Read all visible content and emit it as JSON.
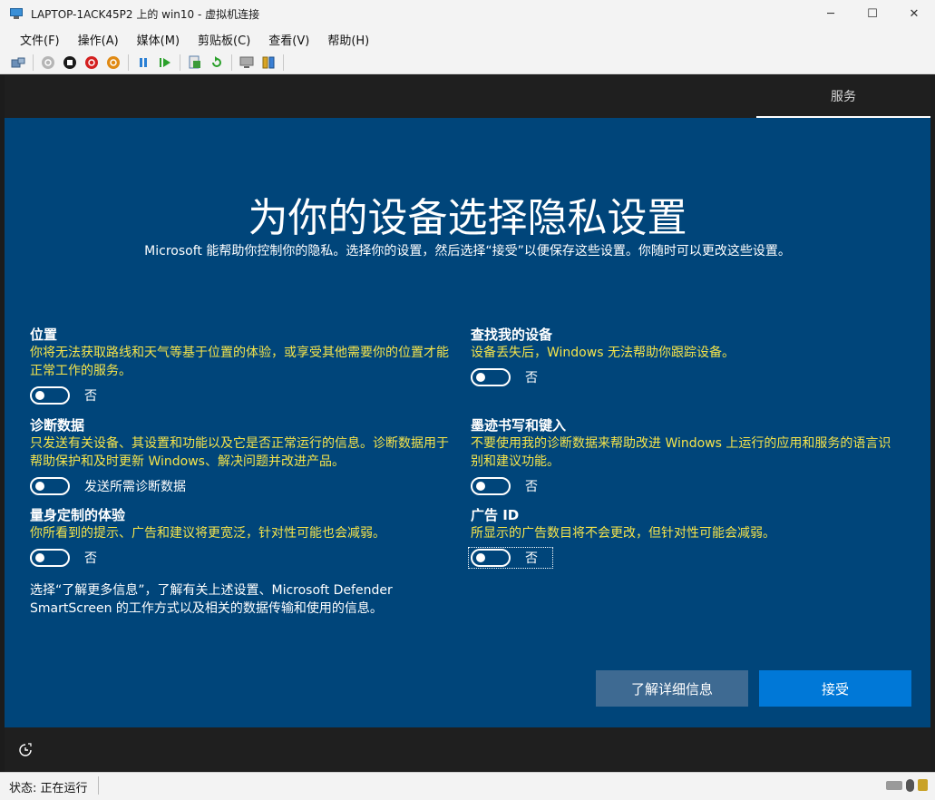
{
  "window": {
    "title": "LAPTOP-1ACK45P2 上的 win10 - 虚拟机连接",
    "controls": {
      "minimize": "─",
      "maximize": "☐",
      "close": "✕"
    }
  },
  "menubar": {
    "items": [
      "文件(F)",
      "操作(A)",
      "媒体(M)",
      "剪贴板(C)",
      "查看(V)",
      "帮助(H)"
    ]
  },
  "toolbar": {
    "icons": [
      "ctrl-alt-del-icon",
      "start-icon",
      "turn-off-icon",
      "shutdown-icon",
      "save-icon",
      "pause-icon",
      "resume-icon",
      "checkpoint-icon",
      "revert-icon",
      "enhanced-session-icon",
      "share-icon"
    ]
  },
  "vm": {
    "top_tab": "服务",
    "title": "为你的设备选择隐私设置",
    "subtitle": "Microsoft 能帮助你控制你的隐私。选择你的设置，然后选择“接受”以便保存这些设置。你随时可以更改这些设置。",
    "settings": {
      "location": {
        "title": "位置",
        "desc": "你将无法获取路线和天气等基于位置的体验，或享受其他需要你的位置才能正常工作的服务。",
        "toggle_label": "否",
        "on": false
      },
      "find_device": {
        "title": "查找我的设备",
        "desc": "设备丢失后，Windows 无法帮助你跟踪设备。",
        "toggle_label": "否",
        "on": false
      },
      "diagnostics": {
        "title": "诊断数据",
        "desc": "只发送有关设备、其设置和功能以及它是否正常运行的信息。诊断数据用于帮助保护和及时更新 Windows、解决问题并改进产品。",
        "toggle_label": "发送所需诊断数据",
        "on": false
      },
      "inking": {
        "title": "墨迹书写和键入",
        "desc": "不要使用我的诊断数据来帮助改进 Windows 上运行的应用和服务的语言识别和建议功能。",
        "toggle_label": "否",
        "on": false
      },
      "tailored": {
        "title": "量身定制的体验",
        "desc": "你所看到的提示、广告和建议将更宽泛，针对性可能也会减弱。",
        "toggle_label": "否",
        "on": false
      },
      "advertising": {
        "title": "广告 ID",
        "desc": "所显示的广告数目将不会更改，但针对性可能会减弱。",
        "toggle_label": "否",
        "on": false
      }
    },
    "info_text": "选择“了解更多信息”，了解有关上述设置、Microsoft Defender SmartScreen 的工作方式以及相关的数据传输和使用的信息。",
    "buttons": {
      "learn_more": "了解详细信息",
      "accept": "接受"
    }
  },
  "statusbar": {
    "status": "状态: 正在运行"
  },
  "colors": {
    "panel_bg": "#00457a",
    "desc_text": "#f5e44b",
    "accept_btn": "#0078d7",
    "learn_more_btn": "#3e6a92"
  }
}
